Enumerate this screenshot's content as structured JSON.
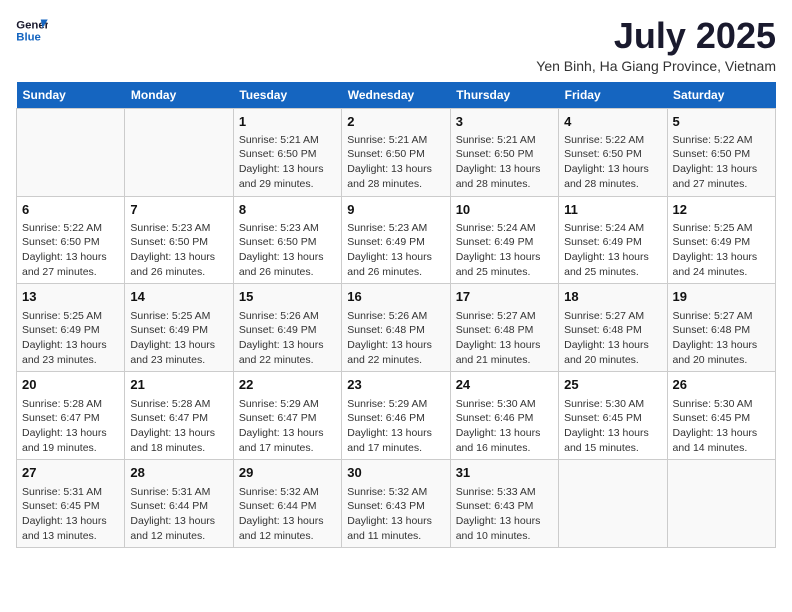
{
  "header": {
    "logo_line1": "General",
    "logo_line2": "Blue",
    "month_year": "July 2025",
    "location": "Yen Binh, Ha Giang Province, Vietnam"
  },
  "weekdays": [
    "Sunday",
    "Monday",
    "Tuesday",
    "Wednesday",
    "Thursday",
    "Friday",
    "Saturday"
  ],
  "weeks": [
    [
      {
        "day": "",
        "info": ""
      },
      {
        "day": "",
        "info": ""
      },
      {
        "day": "1",
        "info": "Sunrise: 5:21 AM\nSunset: 6:50 PM\nDaylight: 13 hours and 29 minutes."
      },
      {
        "day": "2",
        "info": "Sunrise: 5:21 AM\nSunset: 6:50 PM\nDaylight: 13 hours and 28 minutes."
      },
      {
        "day": "3",
        "info": "Sunrise: 5:21 AM\nSunset: 6:50 PM\nDaylight: 13 hours and 28 minutes."
      },
      {
        "day": "4",
        "info": "Sunrise: 5:22 AM\nSunset: 6:50 PM\nDaylight: 13 hours and 28 minutes."
      },
      {
        "day": "5",
        "info": "Sunrise: 5:22 AM\nSunset: 6:50 PM\nDaylight: 13 hours and 27 minutes."
      }
    ],
    [
      {
        "day": "6",
        "info": "Sunrise: 5:22 AM\nSunset: 6:50 PM\nDaylight: 13 hours and 27 minutes."
      },
      {
        "day": "7",
        "info": "Sunrise: 5:23 AM\nSunset: 6:50 PM\nDaylight: 13 hours and 26 minutes."
      },
      {
        "day": "8",
        "info": "Sunrise: 5:23 AM\nSunset: 6:50 PM\nDaylight: 13 hours and 26 minutes."
      },
      {
        "day": "9",
        "info": "Sunrise: 5:23 AM\nSunset: 6:49 PM\nDaylight: 13 hours and 26 minutes."
      },
      {
        "day": "10",
        "info": "Sunrise: 5:24 AM\nSunset: 6:49 PM\nDaylight: 13 hours and 25 minutes."
      },
      {
        "day": "11",
        "info": "Sunrise: 5:24 AM\nSunset: 6:49 PM\nDaylight: 13 hours and 25 minutes."
      },
      {
        "day": "12",
        "info": "Sunrise: 5:25 AM\nSunset: 6:49 PM\nDaylight: 13 hours and 24 minutes."
      }
    ],
    [
      {
        "day": "13",
        "info": "Sunrise: 5:25 AM\nSunset: 6:49 PM\nDaylight: 13 hours and 23 minutes."
      },
      {
        "day": "14",
        "info": "Sunrise: 5:25 AM\nSunset: 6:49 PM\nDaylight: 13 hours and 23 minutes."
      },
      {
        "day": "15",
        "info": "Sunrise: 5:26 AM\nSunset: 6:49 PM\nDaylight: 13 hours and 22 minutes."
      },
      {
        "day": "16",
        "info": "Sunrise: 5:26 AM\nSunset: 6:48 PM\nDaylight: 13 hours and 22 minutes."
      },
      {
        "day": "17",
        "info": "Sunrise: 5:27 AM\nSunset: 6:48 PM\nDaylight: 13 hours and 21 minutes."
      },
      {
        "day": "18",
        "info": "Sunrise: 5:27 AM\nSunset: 6:48 PM\nDaylight: 13 hours and 20 minutes."
      },
      {
        "day": "19",
        "info": "Sunrise: 5:27 AM\nSunset: 6:48 PM\nDaylight: 13 hours and 20 minutes."
      }
    ],
    [
      {
        "day": "20",
        "info": "Sunrise: 5:28 AM\nSunset: 6:47 PM\nDaylight: 13 hours and 19 minutes."
      },
      {
        "day": "21",
        "info": "Sunrise: 5:28 AM\nSunset: 6:47 PM\nDaylight: 13 hours and 18 minutes."
      },
      {
        "day": "22",
        "info": "Sunrise: 5:29 AM\nSunset: 6:47 PM\nDaylight: 13 hours and 17 minutes."
      },
      {
        "day": "23",
        "info": "Sunrise: 5:29 AM\nSunset: 6:46 PM\nDaylight: 13 hours and 17 minutes."
      },
      {
        "day": "24",
        "info": "Sunrise: 5:30 AM\nSunset: 6:46 PM\nDaylight: 13 hours and 16 minutes."
      },
      {
        "day": "25",
        "info": "Sunrise: 5:30 AM\nSunset: 6:45 PM\nDaylight: 13 hours and 15 minutes."
      },
      {
        "day": "26",
        "info": "Sunrise: 5:30 AM\nSunset: 6:45 PM\nDaylight: 13 hours and 14 minutes."
      }
    ],
    [
      {
        "day": "27",
        "info": "Sunrise: 5:31 AM\nSunset: 6:45 PM\nDaylight: 13 hours and 13 minutes."
      },
      {
        "day": "28",
        "info": "Sunrise: 5:31 AM\nSunset: 6:44 PM\nDaylight: 13 hours and 12 minutes."
      },
      {
        "day": "29",
        "info": "Sunrise: 5:32 AM\nSunset: 6:44 PM\nDaylight: 13 hours and 12 minutes."
      },
      {
        "day": "30",
        "info": "Sunrise: 5:32 AM\nSunset: 6:43 PM\nDaylight: 13 hours and 11 minutes."
      },
      {
        "day": "31",
        "info": "Sunrise: 5:33 AM\nSunset: 6:43 PM\nDaylight: 13 hours and 10 minutes."
      },
      {
        "day": "",
        "info": ""
      },
      {
        "day": "",
        "info": ""
      }
    ]
  ]
}
